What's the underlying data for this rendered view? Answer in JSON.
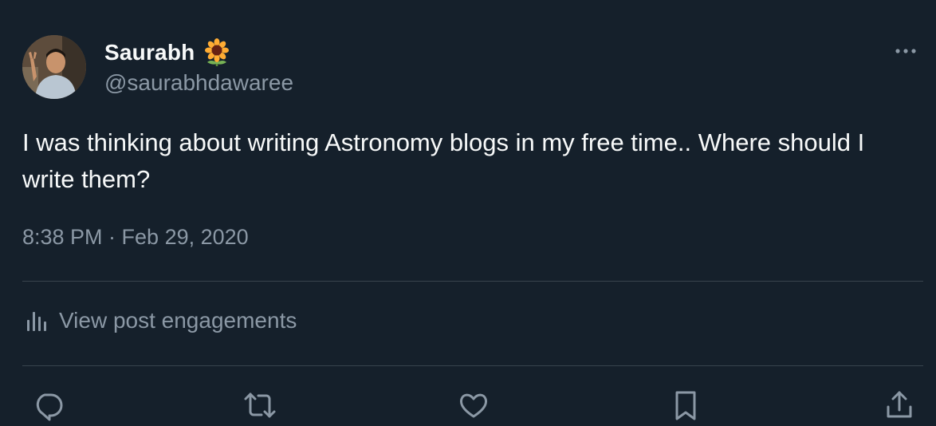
{
  "author": {
    "display_name": "Saurabh",
    "name_emoji": "sunflower-emoji",
    "handle": "@saurabhdawaree",
    "avatar": "profile-photo"
  },
  "tweet": {
    "text": "I was thinking about writing Astronomy blogs in my free time.. Where should I write them?",
    "timestamp": "8:38 PM · Feb 29, 2020"
  },
  "engagements": {
    "label": "View post engagements",
    "icon": "bar-chart-icon"
  },
  "actions": [
    {
      "name": "reply",
      "icon": "reply-icon"
    },
    {
      "name": "repost",
      "icon": "repost-icon"
    },
    {
      "name": "like",
      "icon": "heart-icon"
    },
    {
      "name": "bookmark",
      "icon": "bookmark-icon"
    },
    {
      "name": "share",
      "icon": "share-icon"
    }
  ],
  "menu": {
    "icon": "more-icon"
  },
  "colors": {
    "background": "#15202b",
    "primary_text": "#f7f9f9",
    "secondary_text": "#8b98a5",
    "divider": "#38444d"
  }
}
